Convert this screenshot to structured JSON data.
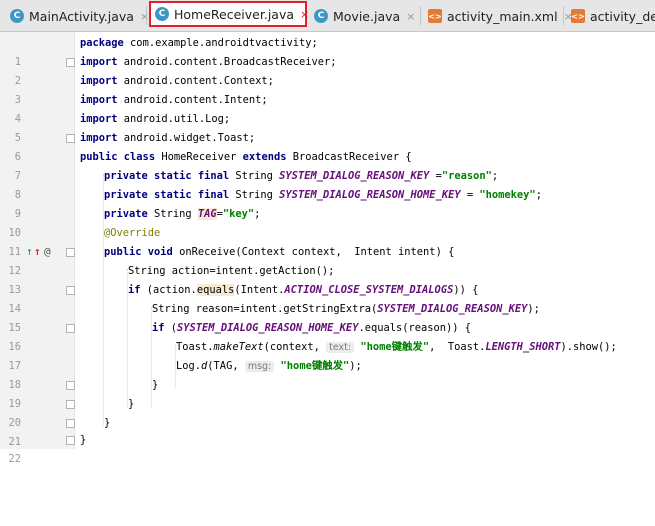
{
  "tabs": [
    {
      "label": "MainActivity.java",
      "type": "java",
      "active": false
    },
    {
      "label": "HomeReceiver.java",
      "type": "java",
      "active": true
    },
    {
      "label": "Movie.java",
      "type": "java",
      "active": false
    },
    {
      "label": "activity_main.xml",
      "type": "xml",
      "active": false
    },
    {
      "label": "activity_det",
      "type": "xml",
      "active": false
    }
  ],
  "icons": {
    "java_class": "C",
    "xml_file": "<>",
    "close": "×",
    "implementing": "↑",
    "override": "@"
  },
  "colors": {
    "keyword": "#000080",
    "string": "#008000",
    "constant": "#660e7a",
    "annotation": "#808000",
    "active_tab_border": "#e0202a"
  },
  "lines": {
    "n": [
      "1",
      "2",
      "3",
      "4",
      "5",
      "6",
      "7",
      "8",
      "9",
      "10",
      "11",
      "12",
      "13",
      "14",
      "15",
      "16",
      "17",
      "18",
      "19",
      "20",
      "21",
      "22"
    ],
    "l1": {
      "kw": "package",
      "rest": " com.example.androidtvactivity;"
    },
    "l2": {
      "kw": "import",
      "rest": " android.content.BroadcastReceiver;"
    },
    "l3": {
      "kw": "import",
      "rest": " android.content.Context;"
    },
    "l4": {
      "kw": "import",
      "rest": " android.content.Intent;"
    },
    "l5": {
      "kw": "import",
      "rest": " android.util.Log;"
    },
    "l6": {
      "kw": "import",
      "rest": " android.widget.Toast;"
    },
    "l7": {
      "kw1": "public class",
      "name": " HomeReceiver ",
      "kw2": "extends",
      "rest": " BroadcastReceiver {"
    },
    "l8": {
      "kw": "private static final",
      "type": " String ",
      "const": "SYSTEM_DIALOG_REASON_KEY",
      "eq": " =",
      "str": "\"reason\"",
      "end": ";"
    },
    "l9": {
      "kw": "private static final",
      "type": " String ",
      "const": "SYSTEM_DIALOG_REASON_HOME_KEY",
      "eq": " = ",
      "str": "\"homekey\"",
      "end": ";"
    },
    "l10": {
      "kw": "private",
      "type": " String ",
      "const": "TAG",
      "eq": "=",
      "str": "\"key\"",
      "end": ";"
    },
    "l11": {
      "ann": "@Override"
    },
    "l12": {
      "kw": "public void",
      "rest": " onReceive(Context context,  Intent intent) {"
    },
    "l13": {
      "text": "String action=intent.getAction();"
    },
    "l14": {
      "kw": "if",
      "a": " (action.",
      "m": "equals",
      "b": "(Intent.",
      "const": "ACTION_CLOSE_SYSTEM_DIALOGS",
      "c": ")) {"
    },
    "l15": {
      "a": "String reason=intent.getStringExtra(",
      "const": "SYSTEM_DIALOG_REASON_KEY",
      "b": ");"
    },
    "l16": {
      "kw": "if",
      "a": " (",
      "const": "SYSTEM_DIALOG_REASON_HOME_KEY",
      "b": ".equals(reason)) {"
    },
    "l17": {
      "a": "Toast.",
      "m": "makeText",
      "b": "(context, ",
      "hint": "text:",
      "str": "\"home键触发\"",
      "c": ",  Toast.",
      "const": "LENGTH_SHORT",
      "d": ").show();"
    },
    "l18": {
      "a": "Log.",
      "m": "d",
      "b": "(TAG, ",
      "hint": "msg:",
      "str": "\"home键触发\"",
      "c": ");"
    },
    "l19": {
      "text": "}"
    },
    "l20": {
      "text": "}"
    },
    "l21": {
      "text": "}"
    },
    "l22": {
      "text": "}"
    }
  }
}
